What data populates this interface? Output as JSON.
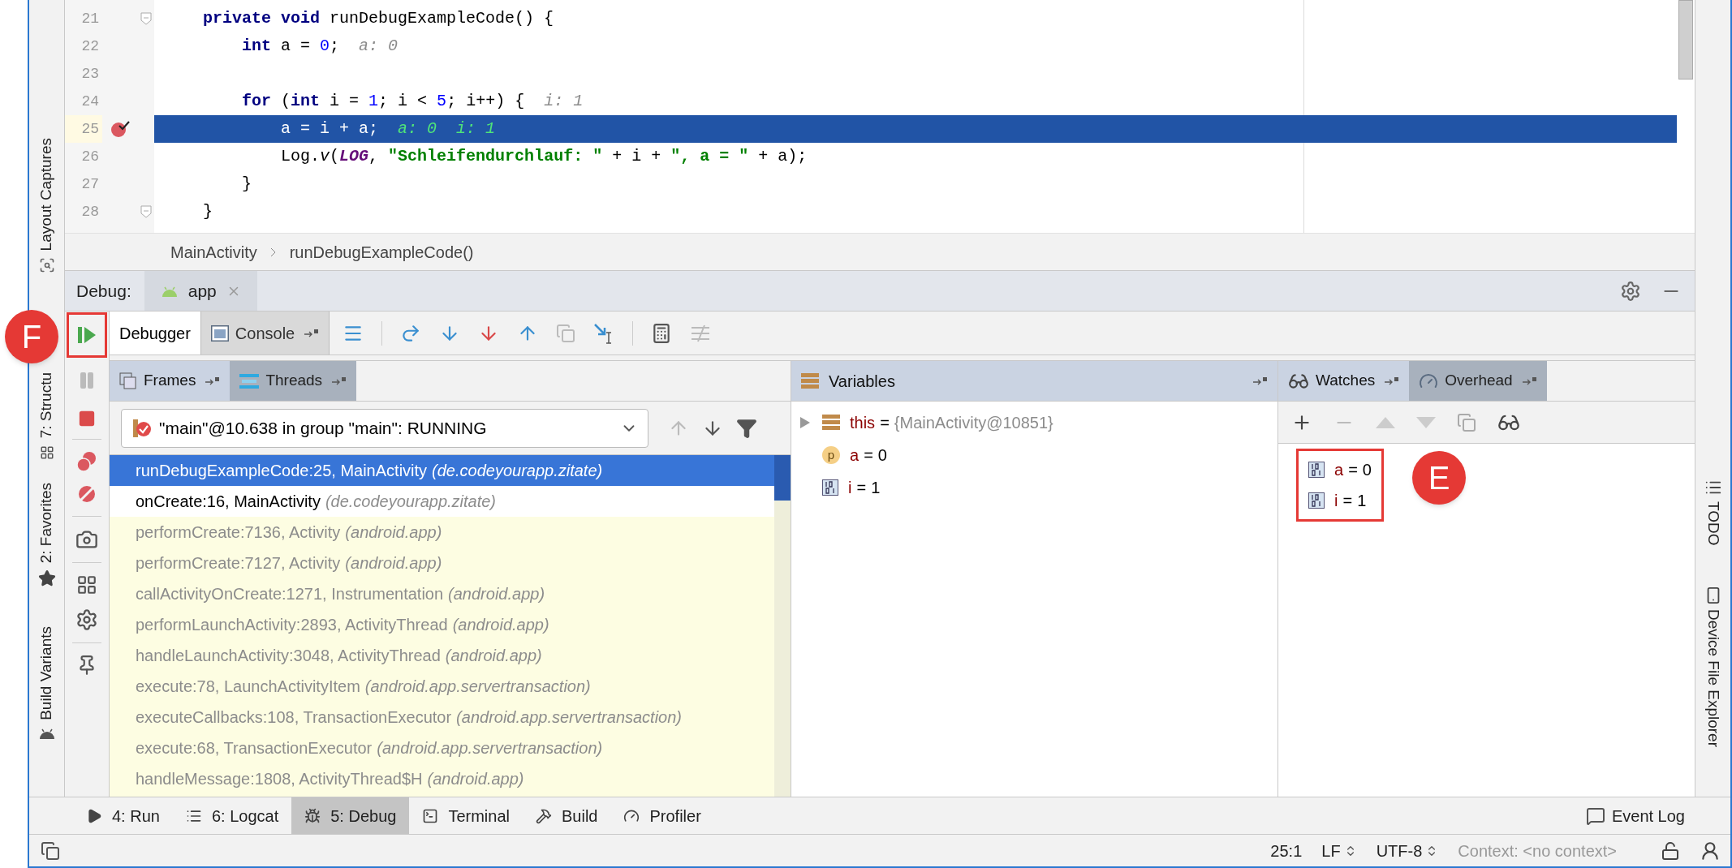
{
  "left_sidebar": {
    "tabs": [
      {
        "label": "Layout Captures"
      },
      {
        "label": "7: Structu"
      },
      {
        "label": "2: Favorites"
      },
      {
        "label": "Build Variants"
      }
    ]
  },
  "editor": {
    "lines": [
      {
        "number": "21",
        "fold": true,
        "breakpoint": false,
        "current": false,
        "tokens": [
          {
            "kind": "kw",
            "text": "    private void"
          },
          {
            "kind": "plain",
            "text": " runDebugExampleCode() {"
          }
        ]
      },
      {
        "number": "22",
        "fold": false,
        "breakpoint": false,
        "current": false,
        "tokens": [
          {
            "kind": "kw",
            "text": "        int"
          },
          {
            "kind": "plain",
            "text": " a = "
          },
          {
            "kind": "num",
            "text": "0"
          },
          {
            "kind": "plain",
            "text": ";"
          }
        ],
        "hints": [
          "a: 0"
        ]
      },
      {
        "number": "23",
        "fold": false,
        "breakpoint": false,
        "current": false
      },
      {
        "number": "24",
        "fold": false,
        "breakpoint": false,
        "current": false,
        "tokens": [
          {
            "kind": "kw",
            "text": "        for"
          },
          {
            "kind": "plain",
            "text": " ("
          },
          {
            "kind": "kw",
            "text": "int"
          },
          {
            "kind": "plain",
            "text": " i = "
          },
          {
            "kind": "num",
            "text": "1"
          },
          {
            "kind": "plain",
            "text": "; i < "
          },
          {
            "kind": "num",
            "text": "5"
          },
          {
            "kind": "plain",
            "text": "; i++) {"
          }
        ],
        "hints": [
          "i: 1"
        ]
      },
      {
        "number": "25",
        "fold": false,
        "breakpoint": true,
        "current": true,
        "tokens": [
          {
            "kind": "plain",
            "text": "            a = i + a;"
          }
        ],
        "hints": [
          "a: 0",
          "i: 1"
        ]
      },
      {
        "number": "26",
        "fold": false,
        "breakpoint": false,
        "current": false,
        "tokens": [
          {
            "kind": "plain",
            "text": "            Log."
          },
          {
            "kind": "italic",
            "text": "v"
          },
          {
            "kind": "plain",
            "text": "("
          },
          {
            "kind": "const",
            "text": "LOG"
          },
          {
            "kind": "plain",
            "text": ", "
          },
          {
            "kind": "str",
            "text": "\"Schleifendurchlauf: \""
          },
          {
            "kind": "plain",
            "text": " + i + "
          },
          {
            "kind": "str",
            "text": "\", a = \""
          },
          {
            "kind": "plain",
            "text": " + a);"
          }
        ]
      },
      {
        "number": "27",
        "fold": false,
        "breakpoint": false,
        "current": false,
        "tokens": [
          {
            "kind": "plain",
            "text": "        }"
          }
        ]
      },
      {
        "number": "28",
        "fold": true,
        "breakpoint": false,
        "current": false,
        "tokens": [
          {
            "kind": "plain",
            "text": "    }"
          }
        ]
      }
    ],
    "breadcrumb": [
      "MainActivity",
      "runDebugExampleCode()"
    ]
  },
  "debug": {
    "label": "Debug:",
    "session_tab": "app",
    "tabs": [
      {
        "label": "Debugger",
        "selected": true
      },
      {
        "label": "Console",
        "selected": false
      }
    ],
    "frames_panel": {
      "tabs": [
        {
          "label": "Frames",
          "selected": true
        },
        {
          "label": "Threads",
          "selected": false
        }
      ],
      "thread": "\"main\"@10.638 in group \"main\": RUNNING",
      "frames": [
        {
          "method": "runDebugExampleCode:25, MainActivity",
          "package": "(de.codeyourapp.zitate)",
          "kind": "user",
          "selected": true
        },
        {
          "method": "onCreate:16, MainActivity",
          "package": "(de.codeyourapp.zitate)",
          "kind": "user",
          "selected": false
        },
        {
          "method": "performCreate:7136, Activity",
          "package": "(android.app)",
          "kind": "library",
          "selected": false
        },
        {
          "method": "performCreate:7127, Activity",
          "package": "(android.app)",
          "kind": "library",
          "selected": false
        },
        {
          "method": "callActivityOnCreate:1271, Instrumentation",
          "package": "(android.app)",
          "kind": "library",
          "selected": false
        },
        {
          "method": "performLaunchActivity:2893, ActivityThread",
          "package": "(android.app)",
          "kind": "library",
          "selected": false
        },
        {
          "method": "handleLaunchActivity:3048, ActivityThread",
          "package": "(android.app)",
          "kind": "library",
          "selected": false
        },
        {
          "method": "execute:78, LaunchActivityItem",
          "package": "(android.app.servertransaction)",
          "kind": "library",
          "selected": false
        },
        {
          "method": "executeCallbacks:108, TransactionExecutor",
          "package": "(android.app.servertransaction)",
          "kind": "library",
          "selected": false
        },
        {
          "method": "execute:68, TransactionExecutor",
          "package": "(android.app.servertransaction)",
          "kind": "library",
          "selected": false
        },
        {
          "method": "handleMessage:1808, ActivityThread$H",
          "package": "(android.app)",
          "kind": "library",
          "selected": false
        }
      ]
    },
    "variables_panel": {
      "title": "Variables",
      "items": [
        {
          "kind": "object",
          "name": "this",
          "op": "=",
          "value": "{MainActivity@10851}"
        },
        {
          "kind": "parameter",
          "icon_letter": "p",
          "name": "a",
          "op": "=",
          "value": "0"
        },
        {
          "kind": "primitive",
          "name": "i",
          "op": "=",
          "value": "1"
        }
      ]
    },
    "watches_panel": {
      "tabs": [
        {
          "label": "Watches",
          "selected": true
        },
        {
          "label": "Overhead",
          "selected": false
        }
      ],
      "items": [
        {
          "name": "a",
          "op": "=",
          "value": "0"
        },
        {
          "name": "i",
          "op": "=",
          "value": "1"
        }
      ]
    }
  },
  "right_sidebar": {
    "tabs": [
      {
        "label": "TODO"
      },
      {
        "label": "Device File Explorer"
      }
    ]
  },
  "tool_windows": [
    {
      "kind": "run",
      "label": "4: Run",
      "selected": false
    },
    {
      "kind": "logcat",
      "label": "6: Logcat",
      "selected": false
    },
    {
      "kind": "debug",
      "label": "5: Debug",
      "selected": true
    },
    {
      "kind": "terminal",
      "label": "Terminal",
      "selected": false
    },
    {
      "kind": "build",
      "label": "Build",
      "selected": false
    },
    {
      "kind": "profiler",
      "label": "Profiler",
      "selected": false
    }
  ],
  "event_log": "Event Log",
  "status_bar": {
    "position": "25:1",
    "line_separator": "LF",
    "encoding": "UTF-8",
    "context": "Context: <no context>"
  },
  "annotations": [
    {
      "label": "F"
    },
    {
      "label": "E"
    }
  ]
}
